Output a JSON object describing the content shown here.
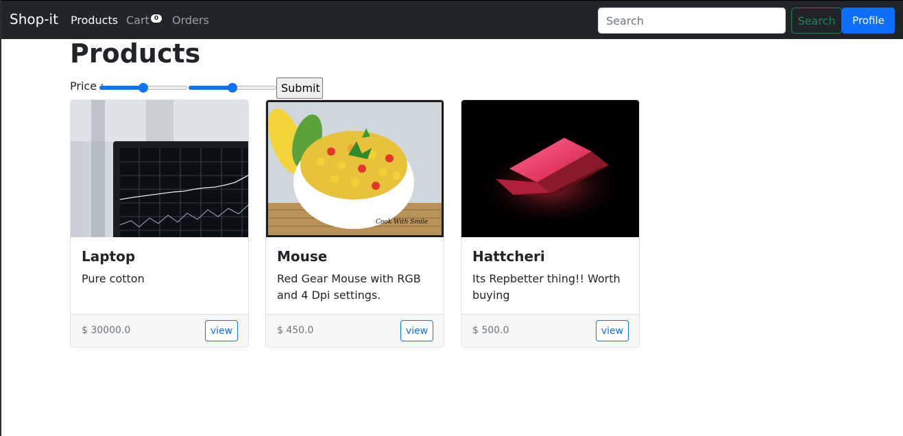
{
  "navbar": {
    "brand": "Shop-it",
    "links": [
      {
        "label": "Products",
        "active": true
      },
      {
        "label": "Cart",
        "badge": "0"
      },
      {
        "label": "Orders"
      }
    ],
    "search": {
      "placeholder": "Search",
      "value": ""
    },
    "search_button": "Search",
    "profile_button": "Profile"
  },
  "page": {
    "title": "Products",
    "price_label": "Price :",
    "price_min_value": 0.5,
    "price_max_value": 0.5,
    "submit_label": "Submit"
  },
  "products": [
    {
      "name": "Laptop",
      "description": "Pure cotton",
      "price": "$ 30000.0",
      "view_label": "view"
    },
    {
      "name": "Mouse",
      "description": "Red Gear Mouse with RGB and 4 Dpi settings.",
      "price": "$ 450.0",
      "view_label": "view"
    },
    {
      "name": "Hattcheri",
      "description": "Its Repbetter thing!! Worth buying",
      "price": "$ 500.0",
      "view_label": "view"
    }
  ],
  "colors": {
    "navbar_bg": "#212529",
    "primary": "#0d6efd",
    "success": "#198754"
  },
  "icons": [
    "laptop-chart-image",
    "corn-salad-image",
    "red-laptop-image"
  ]
}
